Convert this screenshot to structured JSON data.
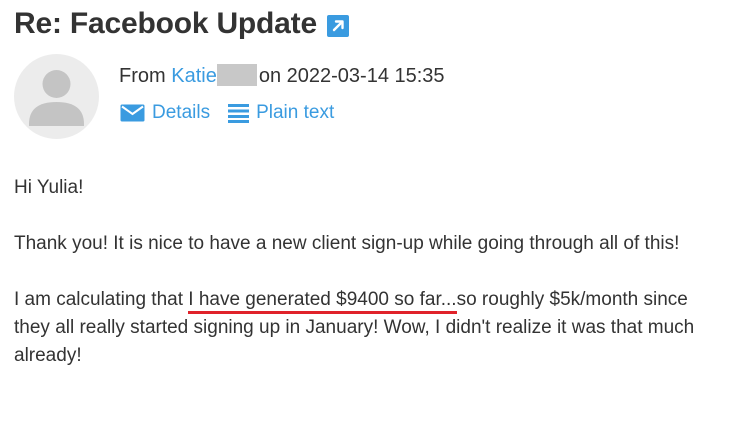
{
  "email": {
    "subject": "Re: Facebook Update",
    "from_label": "From",
    "sender_name": "Katie",
    "date_text": "on 2022-03-14 15:35",
    "actions": {
      "details": "Details",
      "plain_text": "Plain text"
    },
    "body": {
      "greeting": "Hi Yulia!",
      "para1": "Thank you! It is nice to have a new client sign-up while going through all of this!",
      "para2_before": "I am calculating that ",
      "para2_highlight": "I have generated $9400 so far...",
      "para2_after": "so roughly $5k/month since they all really started signing up in January! Wow, I didn't realize it was that much already!"
    }
  },
  "colors": {
    "link": "#3a9be0",
    "text": "#333333",
    "underline": "#e0222a",
    "avatar_bg": "#ececec",
    "avatar_fg": "#c4c4c4",
    "redaction": "#c8c8c8"
  },
  "icons": {
    "external_link": "external-link-icon",
    "details": "envelope-icon",
    "plain_text": "lines-icon",
    "avatar": "user-silhouette-icon"
  }
}
